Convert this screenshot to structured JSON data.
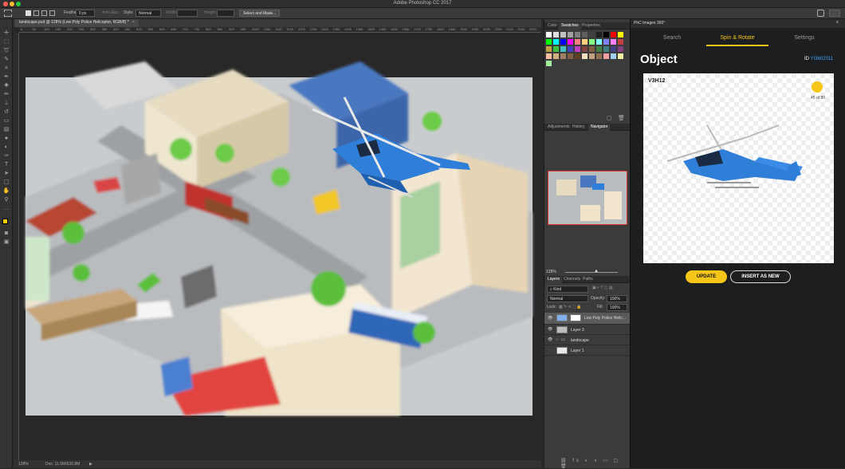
{
  "app": {
    "title": "Adobe Photoshop CC 2017"
  },
  "options": {
    "feather_label": "Feather:",
    "feather_value": "0 px",
    "antialias": "Anti-alias",
    "style_label": "Style:",
    "style_value": "Normal",
    "width_label": "Width:",
    "height_label": "Height:",
    "select_mask_button": "Select and Mask..."
  },
  "document": {
    "tab_title": "landscape.psd @ 128% (Low Poly Police Helicopter, RGB/8) *",
    "ruler_ticks": [
      "0",
      "50",
      "100",
      "150",
      "200",
      "250",
      "300",
      "350",
      "400",
      "450",
      "500",
      "550",
      "600",
      "650",
      "700",
      "750",
      "800",
      "850",
      "900",
      "950",
      "1000",
      "1050",
      "1100",
      "1150",
      "1200",
      "1250",
      "1300",
      "1350",
      "1400",
      "1450",
      "1500",
      "1550",
      "1600",
      "1650",
      "1700",
      "1750",
      "1800",
      "1850",
      "1900",
      "1950",
      "2000",
      "2050",
      "2100",
      "2150",
      "2200"
    ],
    "zoom": "128%",
    "doc_size": "Doc: 11.0M/639.8M"
  },
  "panels": {
    "swatch_tabs": [
      "Color",
      "Swatches",
      "Properties"
    ],
    "swatch_colors": [
      "#ffffff",
      "#e0e0e0",
      "#c0c0c0",
      "#a0a0a0",
      "#808080",
      "#606060",
      "#404040",
      "#202020",
      "#000000",
      "#ff0000",
      "#ffff00",
      "#00ff00",
      "#00ffff",
      "#0000ff",
      "#ff00ff",
      "#ff8080",
      "#ffd080",
      "#80ff80",
      "#80ffff",
      "#8080ff",
      "#ff80ff",
      "#c04040",
      "#c0a040",
      "#40c040",
      "#40c0c0",
      "#4040c0",
      "#c040c0",
      "#804040",
      "#806040",
      "#408040",
      "#408080",
      "#404080",
      "#804080",
      "#ffc0a0",
      "#d0b080",
      "#a08060",
      "#806040",
      "#604020",
      "#f0e0c0",
      "#c0a080",
      "#907050",
      "#f0a0a0",
      "#a0d0f0",
      "#f0f0a0",
      "#a0f0a0"
    ],
    "nav_tabs": [
      "Adjustments",
      "History",
      "Navigator"
    ],
    "nav_zoom": "128%",
    "layers_tabs": [
      "Layers",
      "Channels",
      "Paths"
    ],
    "kind_label": "Kind",
    "blend_mode": "Normal",
    "opacity_label": "Opacity:",
    "opacity_value": "100%",
    "lock_label": "Lock:",
    "fill_label": "Fill:",
    "fill_value": "100%",
    "layers": [
      {
        "name": "Low Poly Police Helic..."
      },
      {
        "name": "Layer 3"
      },
      {
        "name": "landscape"
      },
      {
        "name": "Layer 1"
      }
    ]
  },
  "plugin": {
    "header": "PhC Images 360°",
    "tabs": [
      "Search",
      "Spin & Rotate",
      "Settings"
    ],
    "active_tab": "Spin & Rotate",
    "title": "Object",
    "id_label": "ID",
    "id_value": "YI3602011",
    "card_code": "V3H12",
    "frame_count": "45 of 80",
    "update_button": "UPDATE",
    "insert_button": "INSERT AS NEW",
    "accent_color": "#f5c518"
  }
}
